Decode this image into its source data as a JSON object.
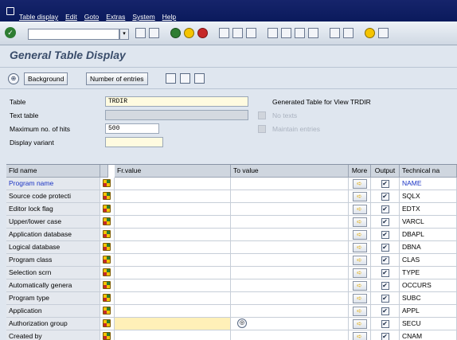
{
  "menu": {
    "items": [
      "Table display",
      "Edit",
      "Goto",
      "Extras",
      "System",
      "Help"
    ]
  },
  "toolbar": {
    "command_value": ""
  },
  "title": "General Table Display",
  "app_toolbar": {
    "background_label": "Background",
    "entries_label": "Number of entries"
  },
  "form": {
    "table_label": "Table",
    "table_value": "TRDIR",
    "texttable_label": "Text table",
    "texttable_value": "",
    "maxhits_label": "Maximum no. of hits",
    "maxhits_value": "500",
    "variant_label": "Display variant",
    "variant_value": "",
    "generated_label": "Generated Table for View TRDIR",
    "no_texts_label": "No texts",
    "maintain_label": "Maintain entries"
  },
  "grid": {
    "headers": {
      "name": "Fld name",
      "from": "Fr.value",
      "to": "To value",
      "more": "More",
      "output": "Output",
      "tech": "Technical na"
    },
    "rows": [
      {
        "name": "Program name",
        "tech": "NAME",
        "checked": true
      },
      {
        "name": "Source code protecti",
        "tech": "SQLX",
        "checked": true
      },
      {
        "name": "Editor lock flag",
        "tech": "EDTX",
        "checked": true
      },
      {
        "name": "Upper/lower case",
        "tech": "VARCL",
        "checked": true
      },
      {
        "name": "Application database",
        "tech": "DBAPL",
        "checked": true
      },
      {
        "name": "Logical database",
        "tech": "DBNA",
        "checked": true
      },
      {
        "name": "Program class",
        "tech": "CLAS",
        "checked": true
      },
      {
        "name": "Selection scrn",
        "tech": "TYPE",
        "checked": true
      },
      {
        "name": "Automatically genera",
        "tech": "OCCURS",
        "checked": true
      },
      {
        "name": "Program type",
        "tech": "SUBC",
        "checked": true
      },
      {
        "name": "Application",
        "tech": "APPL",
        "checked": true
      },
      {
        "name": "Authorization group",
        "tech": "SECU",
        "checked": true
      },
      {
        "name": "Created by",
        "tech": "CNAM",
        "checked": true
      }
    ]
  }
}
